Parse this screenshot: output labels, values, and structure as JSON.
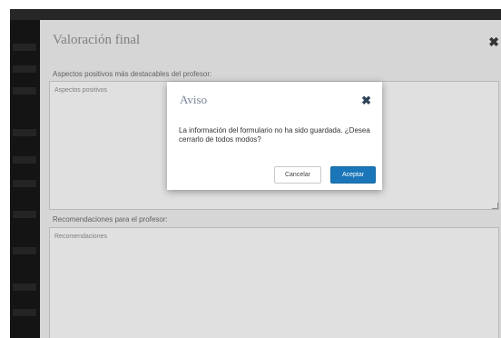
{
  "panel": {
    "title": "Valoración final",
    "close_glyph": "✖",
    "positives_label": "Aspectos positivos más destacables del profesor:",
    "positives_placeholder": "Aspectos positivos",
    "recommendations_label": "Recomendaciones para el profesor:",
    "recommendations_placeholder": "Recomendaciones"
  },
  "modal": {
    "title": "Aviso",
    "close_glyph": "✖",
    "message": "La información del formulario no ha sido guardada. ¿Desea cerrarlo de todos modos?",
    "cancel_label": "Cancelar",
    "accept_label": "Aceptar"
  },
  "colors": {
    "accept_button": "#1a76b8",
    "panel_background": "#e9e9e9",
    "sidebar_background": "#161616"
  },
  "icons": {
    "panel_close": "close-icon",
    "modal_close": "close-icon"
  }
}
